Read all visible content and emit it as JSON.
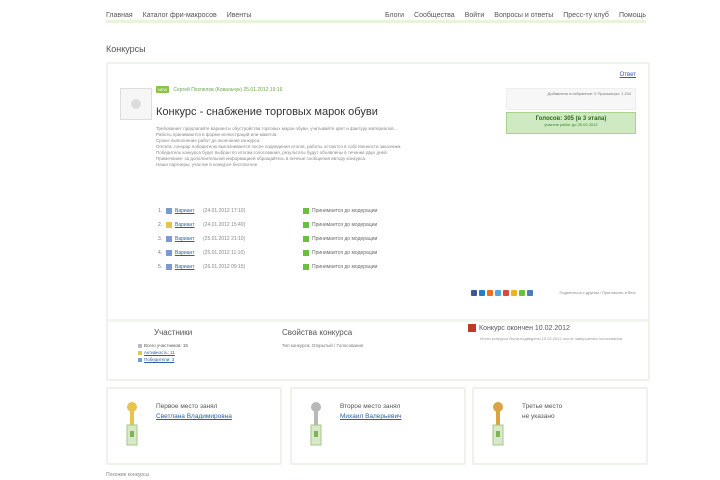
{
  "nav": {
    "left": [
      "Главная",
      "Каталог фри-макросов",
      "Ивенты"
    ],
    "right": [
      "Блоги",
      "Сообщества",
      "Войти",
      "Вопросы и ответы",
      "Пресс-ту клуб",
      "Помощь"
    ]
  },
  "section_title": "Конкурсы",
  "post": {
    "author_badge": "NEW",
    "author_line": "Сергей Поспелов (Ковальчук) 25.01.2012 19:16",
    "report_link": "Ответ",
    "info_box_text": "Добавлено в избранное: 5\nПросмотры: 1 234",
    "green_box_title": "Голосов: 305 (в 3 этапа)",
    "green_box_sub": "участие работ до 25.02.2012",
    "title": "Конкурс - снабжение торговых марок обуви",
    "desc_lines": [
      "Требования: предлагайте варианты обустройства торговых марок обуви, учитывайте цвет и фактуру материалов...",
      "Работы принимаются в форме иллюстраций или макетов.",
      "Сроки: выполнение работ до окончания конкурса.",
      "Оплата: гонорар победителю выплачивается после подведения итогов, работы остаются в собственности заказчика.",
      "Победитель конкурса будет выбран по итогам голосования, результаты будут объявлены в течение двух дней.",
      "Примечание: за дополнительной информацией обращайтесь в личные сообщения автору конкурса.",
      "Наши партнеры: участие в конкурсе бесплатное."
    ],
    "entries": [
      {
        "num": "1.",
        "name": "Вариант",
        "date": "(24.01.2012 17:10)",
        "status": "Принимается до модерации"
      },
      {
        "num": "2.",
        "name": "Вариант",
        "date": "(24.01.2012 15:40)",
        "status": "Принимается до модерации"
      },
      {
        "num": "3.",
        "name": "Вариант",
        "date": "(25.01.2012 21:10)",
        "status": "Принимается до модерации"
      },
      {
        "num": "4.",
        "name": "Вариант",
        "date": "(25.01.2012 11:10)",
        "status": "Принимается до модерации"
      },
      {
        "num": "5.",
        "name": "Вариант",
        "date": "(26.01.2012 09:15)",
        "status": "Принимается до модерации"
      }
    ],
    "share_text": "Поделиться с другом / Пригласить в блог"
  },
  "participants": {
    "title": "Участники",
    "rows": [
      {
        "label": "Всего участников: 15",
        "link": false
      },
      {
        "label": "Активность: 11",
        "link": true
      },
      {
        "label": "Победители: 3",
        "link": true
      }
    ]
  },
  "props": {
    "title": "Свойства конкурса",
    "text": "Тип конкурса: Открытый / Голосование"
  },
  "ended": {
    "title": "Конкурс окончен 10.02.2012",
    "sub": "Итоги конкурса были подведены 10.02.2012 после завершения голосования."
  },
  "prizes": [
    {
      "label": "Первое место занял",
      "name": "Светлана Владимировна",
      "link": true
    },
    {
      "label": "Второе место занял",
      "name": "Михаил Валерьевич",
      "link": true
    },
    {
      "label": "Третье место",
      "name": "не указано",
      "link": false
    }
  ],
  "footer_text": "Похожие конкурсы",
  "colors": {
    "accent_green": "#8bc34a",
    "link_blue": "#2b5ea7",
    "ended_red": "#c0392b"
  }
}
